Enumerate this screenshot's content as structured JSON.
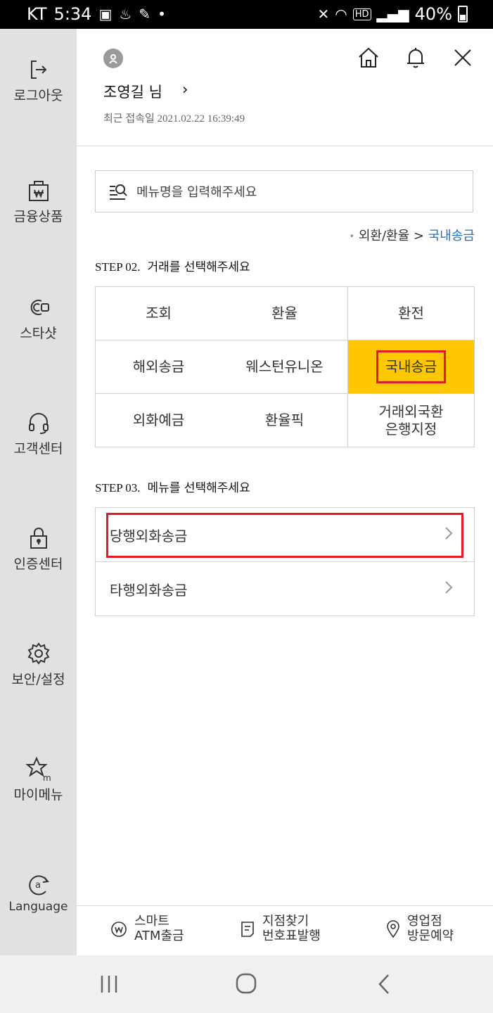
{
  "status_bar": {
    "carrier": "KT",
    "time": "5:34",
    "battery": "40%"
  },
  "sidebar": {
    "items": [
      {
        "label": "로그아웃",
        "icon": "logout-icon"
      },
      {
        "label": "금융상품",
        "icon": "financial-product-icon"
      },
      {
        "label": "스타샷",
        "icon": "starshot-icon"
      },
      {
        "label": "고객센터",
        "icon": "headset-icon"
      },
      {
        "label": "인증센터",
        "icon": "lock-icon"
      },
      {
        "label": "보안/설정",
        "icon": "gear-icon"
      },
      {
        "label": "마이메뉴",
        "icon": "star-m-icon"
      },
      {
        "label": "Language",
        "icon": "language-icon"
      }
    ]
  },
  "header": {
    "username": "조영길 님",
    "last_login": "최근 접속일 2021.02.22 16:39:49"
  },
  "search": {
    "placeholder": "메뉴명을 입력해주세요"
  },
  "breadcrumb": {
    "parent": "외환/환율",
    "separator": ">",
    "current": "국내송금"
  },
  "step2": {
    "number": "STEP 02.",
    "title": "거래를 선택해주세요",
    "options": [
      "조회",
      "환율",
      "환전",
      "해외송금",
      "웨스턴유니온",
      "국내송금",
      "외화예금",
      "환율픽",
      "거래외국환\n은행지정"
    ],
    "selected": "국내송금"
  },
  "step3": {
    "number": "STEP 03.",
    "title": "메뉴를 선택해주세요",
    "items": [
      "당행외화송금",
      "타행외화송금"
    ]
  },
  "bottom_bar": {
    "items": [
      {
        "line1": "스마트",
        "line2": "ATM출금",
        "icon": "won-coin-icon"
      },
      {
        "line1": "지점찾기",
        "line2": "번호표발행",
        "icon": "ticket-icon"
      },
      {
        "line1": "영업점",
        "line2": "방문예약",
        "icon": "location-pin-icon"
      }
    ]
  },
  "colors": {
    "accent_yellow": "#ffc800",
    "highlight_red": "#e01b24",
    "link_blue": "#1a73c8",
    "sidebar_bg": "#e1e1e1"
  }
}
